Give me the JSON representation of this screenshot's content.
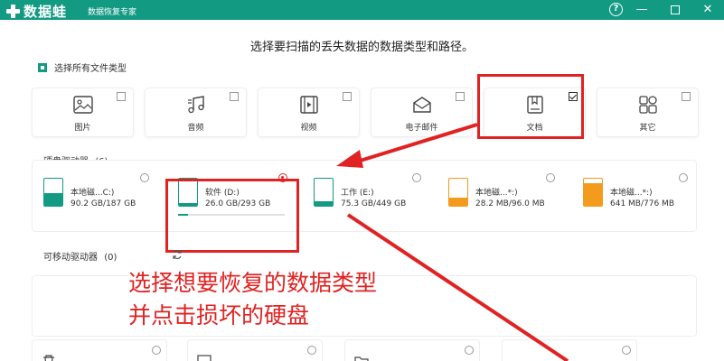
{
  "app": {
    "logo_text": "数据蛙",
    "subtitle": "数据恢复专家",
    "window_controls": {
      "help": "?",
      "minimize": "—",
      "close": "✕"
    }
  },
  "heading": "选择要扫描的丢失数据的数据类型和路径。",
  "select_all": {
    "label": "选择所有文件类型",
    "checked": true
  },
  "file_types": [
    {
      "label": "图片",
      "icon": "image-icon",
      "checked": false
    },
    {
      "label": "音频",
      "icon": "music-icon",
      "checked": false
    },
    {
      "label": "视频",
      "icon": "video-icon",
      "checked": false
    },
    {
      "label": "电子邮件",
      "icon": "email-icon",
      "checked": false
    },
    {
      "label": "文档",
      "icon": "document-icon",
      "checked": true
    },
    {
      "label": "其它",
      "icon": "other-icon",
      "checked": false
    }
  ],
  "hard_drives": {
    "label": "硬盘驱动器",
    "count": "(6)",
    "items": [
      {
        "name": "本地磁...C:)",
        "size": "90.2 GB/187 GB",
        "used_fraction": 0.48,
        "color": "#139a83",
        "selected": false
      },
      {
        "name": "软件 (D:)",
        "size": "26.0 GB/293 GB",
        "used_fraction": 0.09,
        "color": "#139a83",
        "selected": true
      },
      {
        "name": "工作 (E:)",
        "size": "75.3 GB/449 GB",
        "used_fraction": 0.17,
        "color": "#139a83",
        "selected": false
      },
      {
        "name": "本地磁...*:)",
        "size": "28.2 MB/96.0 MB",
        "used_fraction": 0.29,
        "color": "#f29b1d",
        "selected": false
      },
      {
        "name": "本地磁...*:)",
        "size": "641 MB/776 MB",
        "used_fraction": 0.83,
        "color": "#f29b1d",
        "selected": false
      }
    ]
  },
  "removable": {
    "label": "可移动驱动器",
    "count": "(0)"
  },
  "annotation": {
    "line1": "选择想要恢复的数据类型",
    "line2": "并点击损坏的硬盘"
  },
  "colors": {
    "brand": "#139a83",
    "annotation_red": "#e02222",
    "orange": "#f29b1d"
  }
}
